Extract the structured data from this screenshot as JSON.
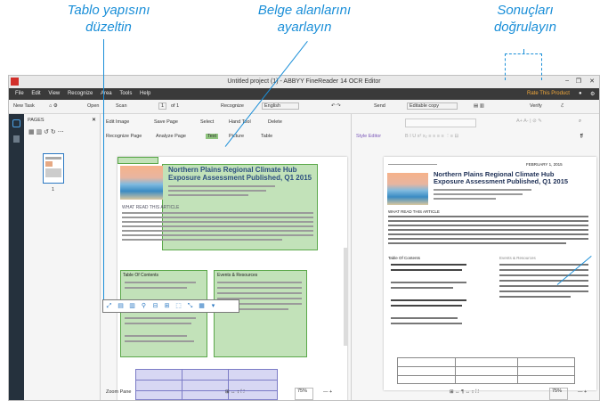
{
  "captions": {
    "fix_layout": "Tablo yapısını\ndüzeltin",
    "adjust_areas": "Belge alanlarını\nayarlayın",
    "verify_results": "Sonuçları\ndoğrulayın"
  },
  "window": {
    "title": "Untitled project (1) - ABBYY FineReader 14 OCR Editor",
    "controls": [
      "–",
      "❐",
      "✕"
    ]
  },
  "menu": [
    "File",
    "Edit",
    "View",
    "Recognize",
    "Area",
    "Tools",
    "Help"
  ],
  "menu_right": {
    "rate": "Rate This Product",
    "bell": "●",
    "gear": "⚙"
  },
  "toolbar": {
    "new_task": "New Task",
    "open": "Open",
    "scan": "Scan",
    "page_num": "1",
    "page_of": "of 1",
    "recognize": "Recognize",
    "language": "English",
    "send": "Send",
    "copy_mode": "Editable copy",
    "verify": "Verify"
  },
  "pages_panel": {
    "title": "PAGES",
    "page_label": "1"
  },
  "image_tools": {
    "edit_image": "Edit Image",
    "save_page": "Save Page",
    "select": "Select",
    "hand_tool": "Hand Tool",
    "delete": "Delete",
    "recognize_page": "Recognize Page",
    "analyze_page": "Analyze Page",
    "text": "Text",
    "picture": "Picture",
    "table": "Table"
  },
  "text_tools": {
    "style_editor": "Style Editor"
  },
  "document": {
    "heading": "Northern Plains Regional Climate Hub Exposure Assessment Published, Q1 2015",
    "section": "WHAT READ THIS ARTICLE",
    "toc": "Table Of Contents",
    "resources": "Events & Resources",
    "date": "FEBRUARY 1, 2015"
  },
  "bottom": {
    "zoom_left": "Zoom Pane",
    "zoom_pct": "75%",
    "zoom_pct2": "75%"
  },
  "colors": {
    "caption": "#1b8fd8",
    "text_zone": "#5ba84a",
    "table_zone": "#7b7bc6",
    "accent": "#2b78c2"
  }
}
